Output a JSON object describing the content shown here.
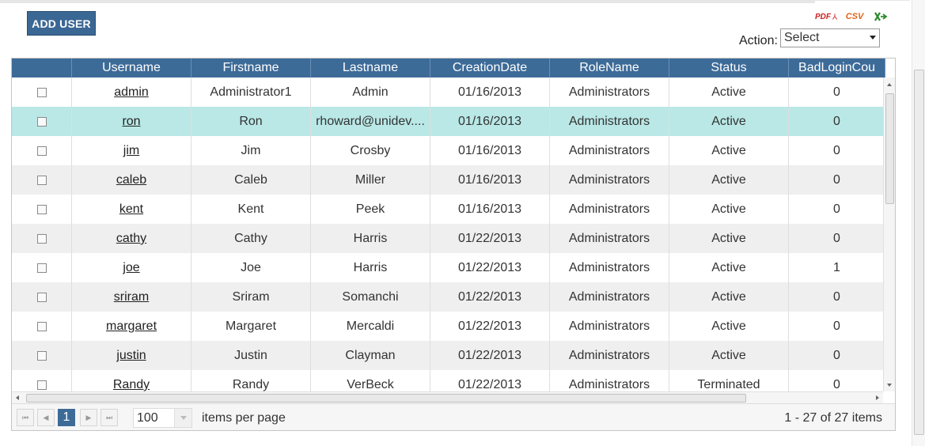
{
  "toolbar": {
    "add_user_label": "ADD USER",
    "export_pdf": "PDF",
    "export_csv": "CSV",
    "export_excel_icon": "excel-icon",
    "action_label": "Action:",
    "action_selected": "Select"
  },
  "grid": {
    "columns": [
      "",
      "Username",
      "Firstname",
      "Lastname",
      "CreationDate",
      "RoleName",
      "Status",
      "BadLoginCou"
    ],
    "rows": [
      [
        "admin",
        "Administrator1",
        "Admin",
        "01/16/2013",
        "Administrators",
        "Active",
        "0"
      ],
      [
        "ron",
        "Ron",
        "rhoward@unidev....",
        "01/16/2013",
        "Administrators",
        "Active",
        "0"
      ],
      [
        "jim",
        "Jim",
        "Crosby",
        "01/16/2013",
        "Administrators",
        "Active",
        "0"
      ],
      [
        "caleb",
        "Caleb",
        "Miller",
        "01/16/2013",
        "Administrators",
        "Active",
        "0"
      ],
      [
        "kent",
        "Kent",
        "Peek",
        "01/16/2013",
        "Administrators",
        "Active",
        "0"
      ],
      [
        "cathy",
        "Cathy",
        "Harris",
        "01/22/2013",
        "Administrators",
        "Active",
        "0"
      ],
      [
        "joe",
        "Joe",
        "Harris",
        "01/22/2013",
        "Administrators",
        "Active",
        "1"
      ],
      [
        "sriram",
        "Sriram",
        "Somanchi",
        "01/22/2013",
        "Administrators",
        "Active",
        "0"
      ],
      [
        "margaret",
        "Margaret",
        "Mercaldi",
        "01/22/2013",
        "Administrators",
        "Active",
        "0"
      ],
      [
        "justin",
        "Justin",
        "Clayman",
        "01/22/2013",
        "Administrators",
        "Active",
        "0"
      ],
      [
        "Randy",
        "Randy",
        "VerBeck",
        "01/22/2013",
        "Administrators",
        "Terminated",
        "0"
      ]
    ],
    "selected_row_index": 1
  },
  "pager": {
    "first_icon": "first-page-icon",
    "prev_icon": "prev-page-icon",
    "current_page": "1",
    "next_icon": "next-page-icon",
    "last_icon": "last-page-icon",
    "page_size": "100",
    "items_per_page_label": "items per page",
    "range_text": "1 - 27 of 27 items"
  }
}
